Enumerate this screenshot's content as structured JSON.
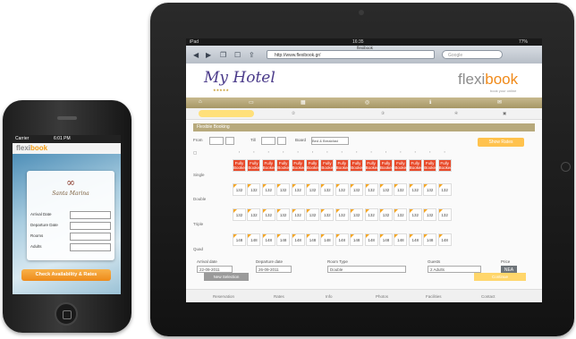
{
  "phone": {
    "status_carrier": "Carrier",
    "status_time": "6:01 PM",
    "logo_prefix": "flexi",
    "logo_suffix": "book",
    "hotel_brand": "Santa Marina",
    "form_rows": [
      "Arrival Date",
      "Departure Date",
      "Rooms",
      "Adults"
    ],
    "cta_label": "Check Availability & Rates"
  },
  "tablet": {
    "status_left": "iPad",
    "status_time": "16:35",
    "status_battery": "77%",
    "tab_title": "flexibook",
    "url": "http://www.flexibook.gr/",
    "search_placeholder": "Google",
    "hotel_name": "My Hotel",
    "hotel_stars": "★★★★★",
    "logo_prefix": "flexi",
    "logo_suffix": "book",
    "logo_tag": "book your online",
    "section_title": "Flexible Booking",
    "filters": {
      "from_label": "From",
      "to_label": "Till",
      "board_label": "Board",
      "board_value": "Bed & Breakfast",
      "show_rates": "Show Rates"
    },
    "row_labels": [
      "Single",
      "Double",
      "Triple",
      "Quad"
    ],
    "badge_text": "Fully Booked",
    "prices": [
      "132",
      "132",
      "132",
      "132",
      "132",
      "132",
      "132",
      "132",
      "132",
      "132",
      "132",
      "132",
      "132",
      "132",
      "132"
    ],
    "prices_row3": [
      "148",
      "148",
      "148",
      "148",
      "148",
      "148",
      "148",
      "148",
      "148",
      "148",
      "148",
      "148",
      "148",
      "148",
      "148"
    ],
    "lower": {
      "checkin_label": "Arrival date",
      "checkin_value": "22-09-2011",
      "checkout_label": "Departure date",
      "checkout_value": "26-09-2011",
      "room_label": "Room Type",
      "room_value": "Double",
      "guests_label": "Guests",
      "guests_value": "2 Adults",
      "price_label": "Price",
      "nea": "NEA"
    },
    "new_selection": "New Selection",
    "continue": "Continue",
    "footer": [
      "Reservation",
      "Rates",
      "Info",
      "Photos",
      "Facilities",
      "Contact"
    ]
  }
}
